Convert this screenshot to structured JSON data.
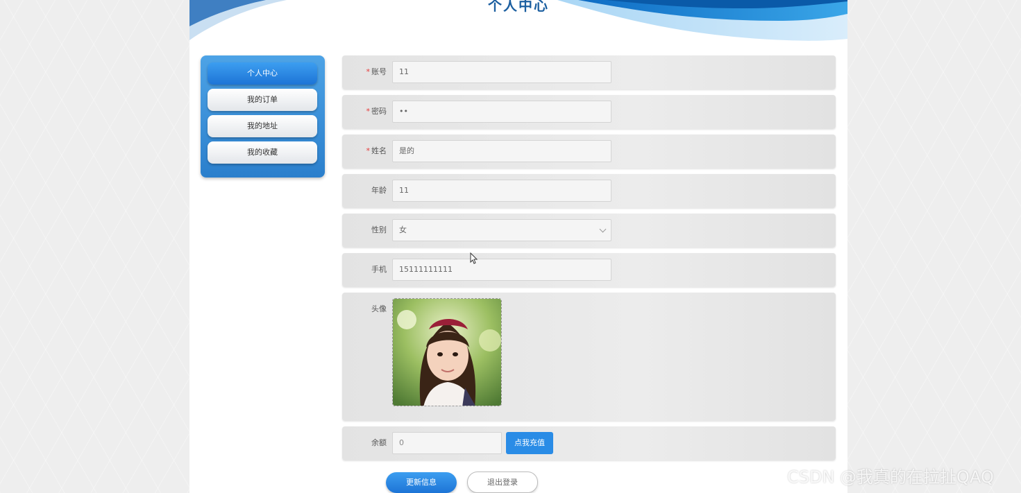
{
  "header": {
    "title": "个人中心"
  },
  "sidebar": {
    "items": [
      {
        "label": "个人中心",
        "active": true
      },
      {
        "label": "我的订单",
        "active": false
      },
      {
        "label": "我的地址",
        "active": false
      },
      {
        "label": "我的收藏",
        "active": false
      }
    ]
  },
  "form": {
    "account": {
      "label": "账号",
      "required": "*",
      "value": "11"
    },
    "password": {
      "label": "密码",
      "required": "*",
      "value": "••"
    },
    "name": {
      "label": "姓名",
      "required": "*",
      "value": "是的"
    },
    "age": {
      "label": "年龄",
      "value": "11"
    },
    "gender": {
      "label": "性别",
      "value": "女"
    },
    "phone": {
      "label": "手机",
      "value": "15111111111"
    },
    "avatar": {
      "label": "头像",
      "icon": "avatar-photo"
    },
    "balance": {
      "label": "余额",
      "value": "0",
      "recharge_label": "点我充值"
    }
  },
  "actions": {
    "update_label": "更新信息",
    "logout_label": "退出登录"
  },
  "watermark": "CSDN @我真的在拉扯QAQ",
  "colors": {
    "accent": "#2a8ce6",
    "header_blue": "#1c5fa0",
    "required": "#e63b3b"
  }
}
